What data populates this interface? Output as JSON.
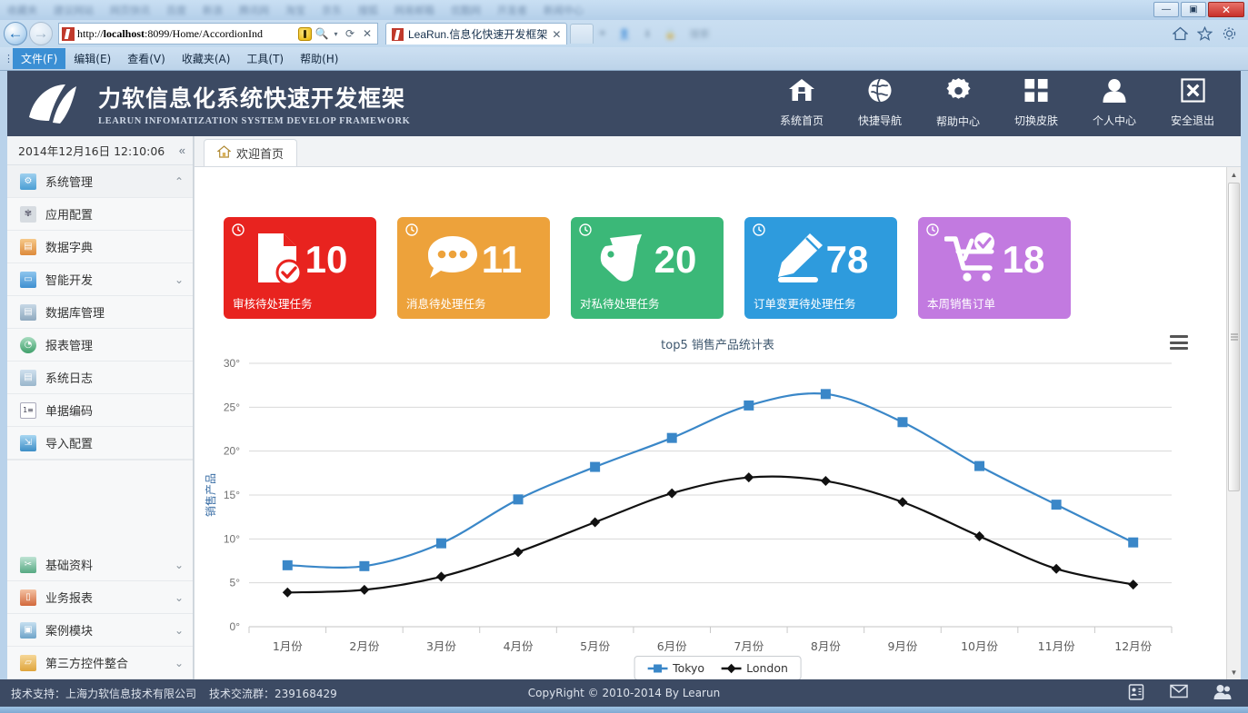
{
  "browser": {
    "bookmarks_blurred": [
      "收藏夹",
      "建议网站",
      "网页快讯",
      "百度",
      "新浪",
      "腾讯网",
      "淘宝",
      "京东",
      "搜狐",
      "网易邮箱",
      "优酷网",
      "开发者",
      "新闻中心"
    ],
    "window_buttons": {
      "minimize": "—",
      "maximize": "▣",
      "close": "✕"
    },
    "address": {
      "url_prefix": "http://",
      "url_host": "localhost",
      "url_rest": ":8099/Home/AccordionInd",
      "go_icon": "refresh-icon",
      "search_icon": "search-icon",
      "stop_icon": "stop-icon",
      "compat_icon": "compatibility-view-icon"
    },
    "tab": {
      "title": "LeaRun.信息化快速开发框架",
      "close": "✕"
    },
    "right_icons": [
      "home-icon",
      "favorites-star-icon",
      "settings-gear-icon"
    ],
    "menubar": [
      {
        "label": "文件(F)",
        "active": true
      },
      {
        "label": "编辑(E)",
        "active": false
      },
      {
        "label": "查看(V)",
        "active": false
      },
      {
        "label": "收藏夹(A)",
        "active": false
      },
      {
        "label": "工具(T)",
        "active": false
      },
      {
        "label": "帮助(H)",
        "active": false
      }
    ]
  },
  "header": {
    "brand_cn": "力软信息化系统快速开发框架",
    "brand_en": "LEARUN  INFOMATIZATION  SYSTEM  DEVELOP  FRAMEWORK",
    "bg_color": "#3c4a63",
    "nav": [
      {
        "icon": "home-icon",
        "label": "系统首页"
      },
      {
        "icon": "globe-icon",
        "label": "快捷导航"
      },
      {
        "icon": "gear-icon",
        "label": "帮助中心"
      },
      {
        "icon": "grid-squares-icon",
        "label": "切换皮肤"
      },
      {
        "icon": "person-icon",
        "label": "个人中心"
      },
      {
        "icon": "exit-box-x-icon",
        "label": "安全退出"
      }
    ]
  },
  "sidebar": {
    "clock": "2014年12月16日 12:10:06",
    "collapse_icon": "«",
    "items": [
      {
        "label": "系统管理",
        "icon": "system-gear-lock-icon",
        "chevron": "⌃",
        "selected": true
      },
      {
        "label": "应用配置",
        "icon": "config-gear-icon",
        "chevron": ""
      },
      {
        "label": "数据字典",
        "icon": "book-icon",
        "chevron": ""
      },
      {
        "label": "智能开发",
        "icon": "monitor-icon",
        "chevron": "⌄"
      },
      {
        "label": "数据库管理",
        "icon": "database-icon",
        "chevron": ""
      },
      {
        "label": "报表管理",
        "icon": "report-chart-icon",
        "chevron": ""
      },
      {
        "label": "系统日志",
        "icon": "log-document-icon",
        "chevron": ""
      },
      {
        "label": "单据编码",
        "icon": "numbered-list-icon",
        "chevron": ""
      },
      {
        "label": "导入配置",
        "icon": "import-icon",
        "chevron": ""
      }
    ],
    "bottom_items": [
      {
        "label": "基础资料",
        "icon": "tools-icon",
        "chevron": "⌄"
      },
      {
        "label": "业务报表",
        "icon": "bar-chart-icon",
        "chevron": "⌄"
      },
      {
        "label": "案例模块",
        "icon": "case-module-icon",
        "chevron": "⌄"
      },
      {
        "label": "第三方控件整合",
        "icon": "folder-plugin-icon",
        "chevron": "⌄"
      }
    ]
  },
  "content": {
    "tab": {
      "label": "欢迎首页",
      "icon": "home-icon"
    },
    "tiles": [
      {
        "label": "审核待处理任务",
        "value": "10",
        "color": "#e8231f",
        "icon": "document-check-icon",
        "badge": "clock-icon"
      },
      {
        "label": "消息待处理任务",
        "value": "11",
        "color": "#eda23b",
        "icon": "speech-bubble-icon",
        "badge": "clock-icon"
      },
      {
        "label": "对私待处理任务",
        "value": "20",
        "color": "#3bb878",
        "icon": "tags-icon",
        "badge": "clock-icon"
      },
      {
        "label": "订单变更待处理任务",
        "value": "78",
        "color": "#2e9bdd",
        "icon": "pencil-edit-icon",
        "badge": "clock-icon"
      },
      {
        "label": "本周销售订单",
        "value": "18",
        "color": "#c27ae0",
        "icon": "cart-check-icon",
        "badge": "clock-icon"
      }
    ],
    "chart_menu_icon": "hamburger-menu-icon"
  },
  "chart_data": {
    "type": "line",
    "title": "top5 销售产品统计表",
    "xlabel": "",
    "ylabel": "销售产品",
    "categories": [
      "1月份",
      "2月份",
      "3月份",
      "4月份",
      "5月份",
      "6月份",
      "7月份",
      "8月份",
      "9月份",
      "10月份",
      "11月份",
      "12月份"
    ],
    "yticks": [
      "0°",
      "5°",
      "10°",
      "15°",
      "20°",
      "25°",
      "30°"
    ],
    "ylim": [
      0,
      30
    ],
    "grid": true,
    "legend_position": "bottom",
    "series": [
      {
        "name": "Tokyo",
        "color": "#3a87c8",
        "marker": "square",
        "values": [
          7.0,
          6.9,
          9.5,
          14.5,
          18.2,
          21.5,
          25.2,
          26.5,
          23.3,
          18.3,
          13.9,
          9.6
        ]
      },
      {
        "name": "London",
        "color": "#111111",
        "marker": "diamond",
        "values": [
          3.9,
          4.2,
          5.7,
          8.5,
          11.9,
          15.2,
          17.0,
          16.6,
          14.2,
          10.3,
          6.6,
          4.8
        ]
      }
    ]
  },
  "footer": {
    "support": "技术支持：上海力软信息技术有限公司",
    "qq_group": "技术交流群：239168429",
    "copyright": "CopyRight © 2010-2014 By Learun",
    "icons": [
      "contact-card-icon",
      "envelope-icon",
      "users-icon"
    ]
  }
}
